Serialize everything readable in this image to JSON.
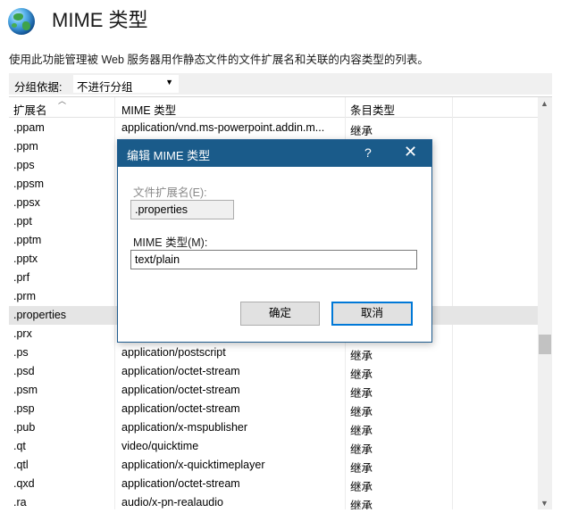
{
  "header": {
    "title": "MIME 类型",
    "description": "使用此功能管理被 Web 服务器用作静态文件的文件扩展名和关联的内容类型的列表。"
  },
  "groupbar": {
    "label": "分组依据:",
    "selected": "不进行分组"
  },
  "columns": [
    "扩展名",
    "MIME 类型",
    "条目类型"
  ],
  "rows": [
    {
      "ext": ".ppam",
      "mime": "application/vnd.ms-powerpoint.addin.m...",
      "entry": "继承"
    },
    {
      "ext": ".ppm",
      "mime": "",
      "entry": ""
    },
    {
      "ext": ".pps",
      "mime": "",
      "entry": ""
    },
    {
      "ext": ".ppsm",
      "mime": "",
      "entry": ""
    },
    {
      "ext": ".ppsx",
      "mime": "",
      "entry": ""
    },
    {
      "ext": ".ppt",
      "mime": "",
      "entry": ""
    },
    {
      "ext": ".pptm",
      "mime": "",
      "entry": ""
    },
    {
      "ext": ".pptx",
      "mime": "",
      "entry": ""
    },
    {
      "ext": ".prf",
      "mime": "",
      "entry": ""
    },
    {
      "ext": ".prm",
      "mime": "",
      "entry": ""
    },
    {
      "ext": ".properties",
      "mime": "",
      "entry": ""
    },
    {
      "ext": ".prx",
      "mime": "",
      "entry": ""
    },
    {
      "ext": ".ps",
      "mime": "application/postscript",
      "entry": "继承"
    },
    {
      "ext": ".psd",
      "mime": "application/octet-stream",
      "entry": "继承"
    },
    {
      "ext": ".psm",
      "mime": "application/octet-stream",
      "entry": "继承"
    },
    {
      "ext": ".psp",
      "mime": "application/octet-stream",
      "entry": "继承"
    },
    {
      "ext": ".pub",
      "mime": "application/x-mspublisher",
      "entry": "继承"
    },
    {
      "ext": ".qt",
      "mime": "video/quicktime",
      "entry": "继承"
    },
    {
      "ext": ".qtl",
      "mime": "application/x-quicktimeplayer",
      "entry": "继承"
    },
    {
      "ext": ".qxd",
      "mime": "application/octet-stream",
      "entry": "继承"
    },
    {
      "ext": ".ra",
      "mime": "audio/x-pn-realaudio",
      "entry": "继承"
    }
  ],
  "selected_row_index": 10,
  "dialog": {
    "title": "编辑 MIME 类型",
    "help": "?",
    "close": "✕",
    "ext_label": "文件扩展名(E):",
    "ext_value": ".properties",
    "mime_label": "MIME 类型(M):",
    "mime_value": "text/plain",
    "ok_label": "确定",
    "cancel_label": "取消"
  },
  "colors": {
    "dialog_titlebar": "#1a5b8a",
    "focus_border": "#0078d7",
    "selected_row": "#e5e5e5"
  }
}
